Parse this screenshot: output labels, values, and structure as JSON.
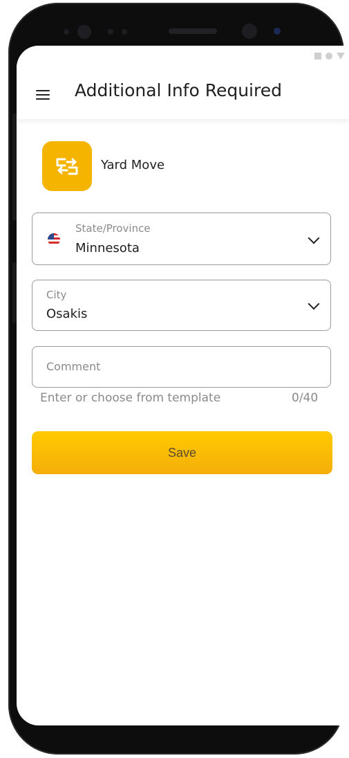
{
  "app_bar": {
    "title": "Additional Info Required"
  },
  "activity": {
    "label": "Yard Move",
    "icon": "yard-move-icon",
    "accent_color": "#f5b400"
  },
  "form": {
    "state": {
      "label": "State/Province",
      "value": "Minnesota",
      "icon": "us-flag-icon"
    },
    "city": {
      "label": "City",
      "value": "Osakis"
    },
    "comment": {
      "placeholder": "Comment",
      "helper": "Enter or choose from template",
      "counter": "0/40"
    }
  },
  "actions": {
    "save_label": "Save",
    "save_color": "#ffc400"
  }
}
